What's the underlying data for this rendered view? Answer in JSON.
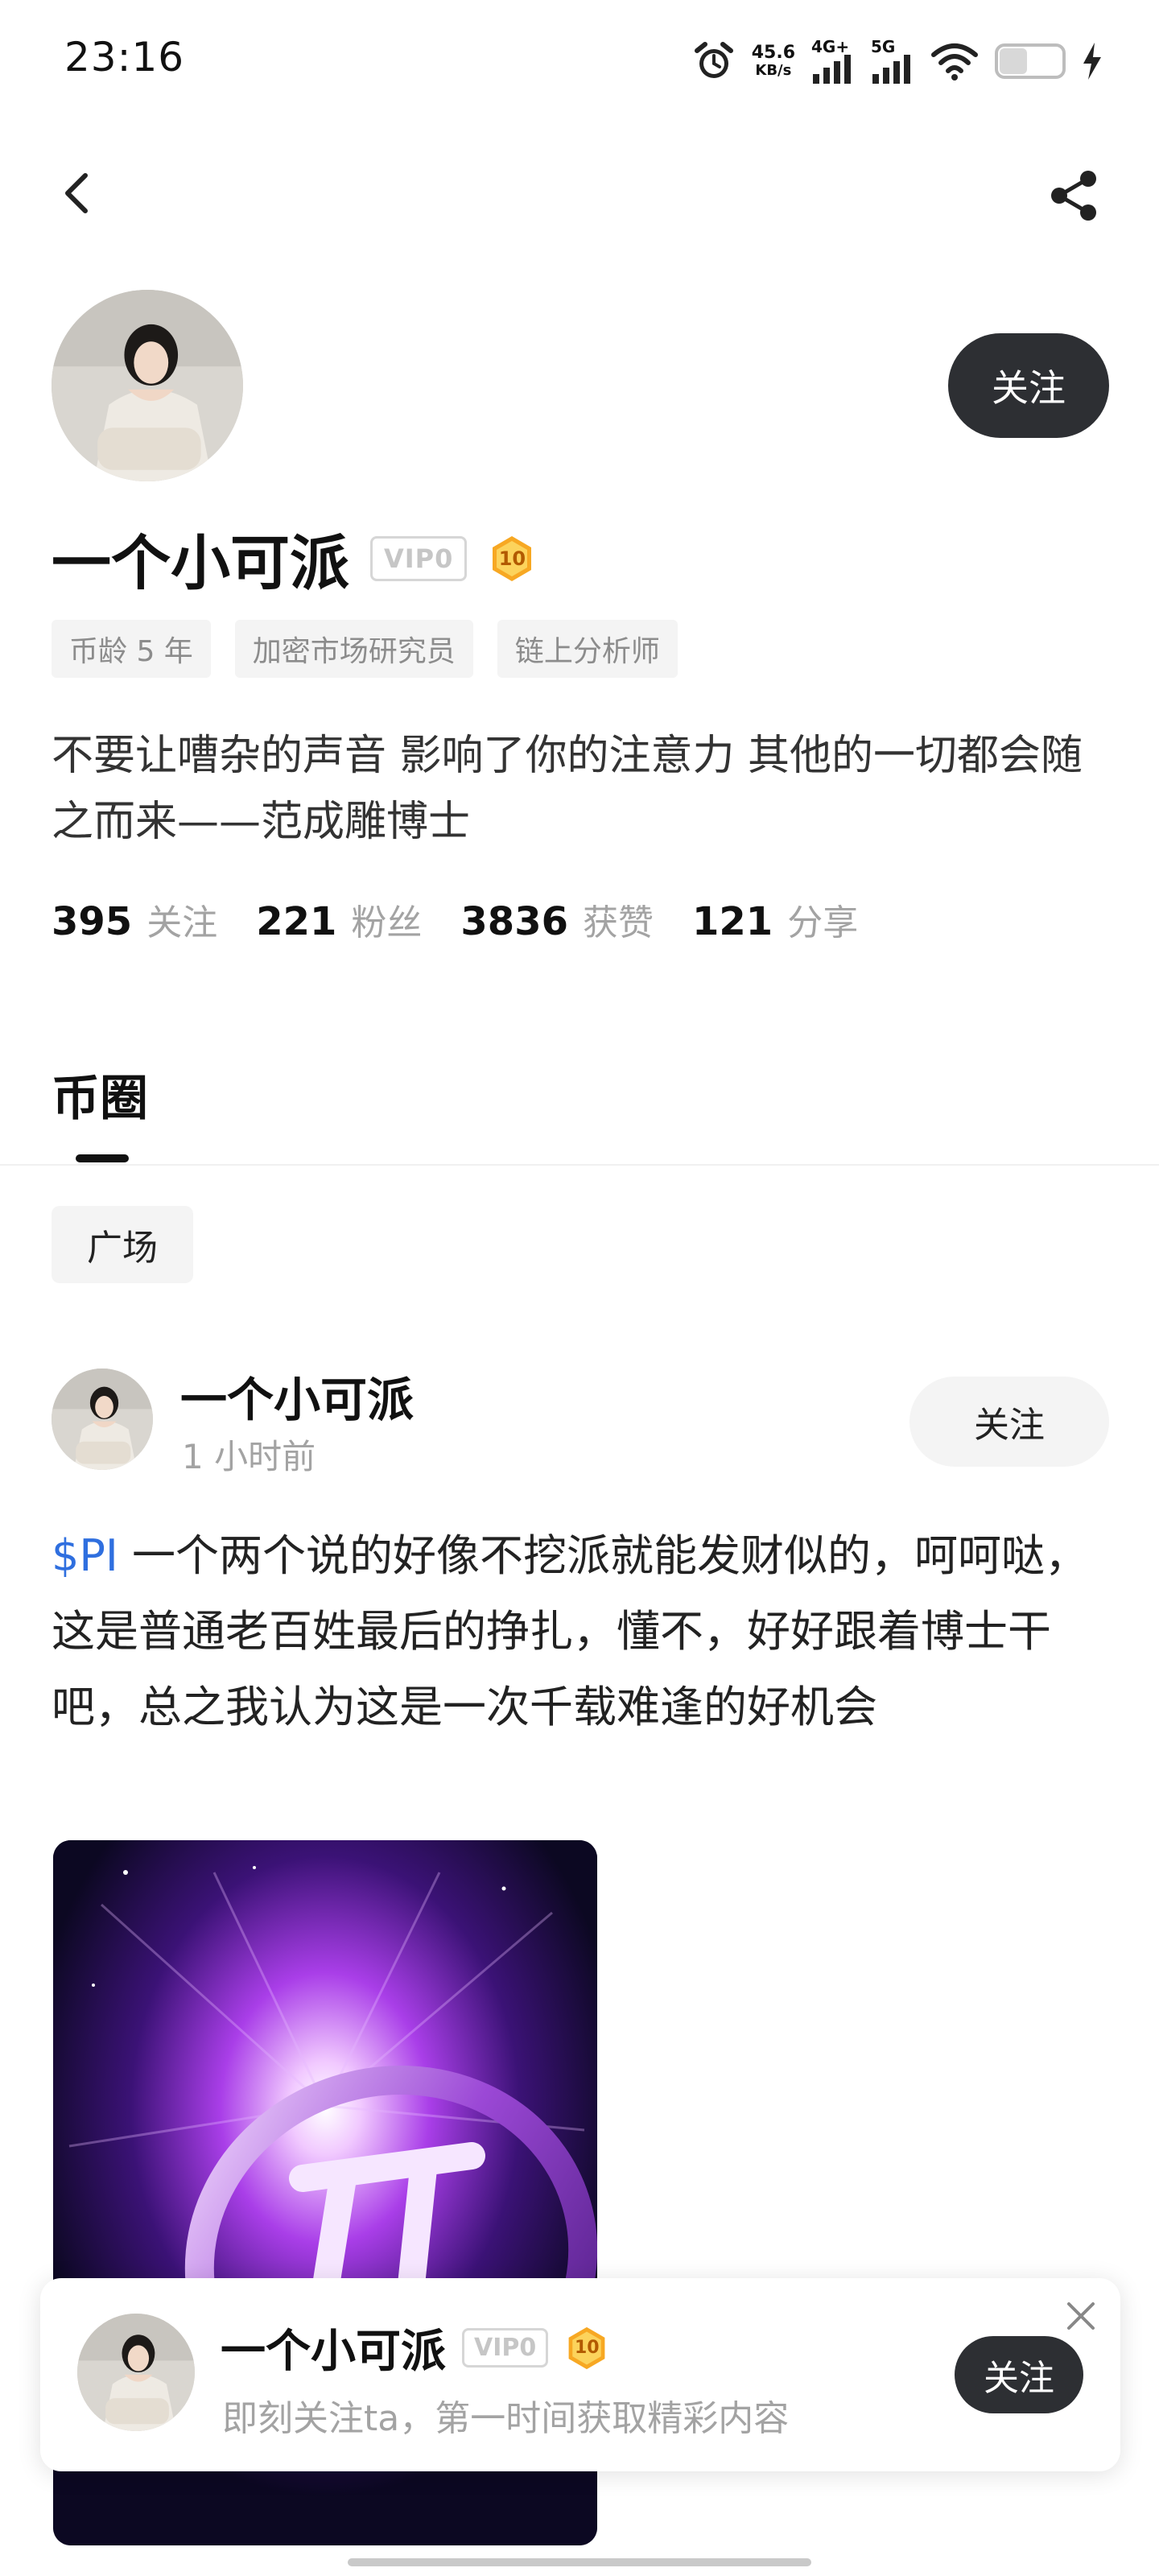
{
  "status_bar": {
    "time": "23:16",
    "net_speed_value": "45.6",
    "net_speed_unit": "KB/s",
    "signal_1": "4G+",
    "signal_2": "5G",
    "icons": [
      "alarm-icon",
      "wifi-icon",
      "battery-icon",
      "charging-icon"
    ]
  },
  "nav": {
    "back_icon": "chevron-left-icon",
    "share_icon": "share-icon"
  },
  "profile": {
    "name": "一个小可派",
    "vip_label": "VIP0",
    "level": "10",
    "follow_label": "关注",
    "tags": [
      "币龄 5 年",
      "加密市场研究员",
      "链上分析师"
    ],
    "bio": "不要让嘈杂的声音 影响了你的注意力 其他的一切都会随之而来——范成雕博士",
    "stats": [
      {
        "value": "395",
        "label": "关注"
      },
      {
        "value": "221",
        "label": "粉丝"
      },
      {
        "value": "3836",
        "label": "获赞"
      },
      {
        "value": "121",
        "label": "分享"
      }
    ]
  },
  "tabs": {
    "active": "币圈"
  },
  "filter": {
    "chip": "广场"
  },
  "post": {
    "author": "一个小可派",
    "time": "1 小时前",
    "follow_label": "关注",
    "ticker": "$PI",
    "text": " 一个两个说的好像不挖派就能发财似的，呵呵哒，这是普通老百姓最后的挣扎，懂不，好好跟着博士干吧，总之我认为这是一次千载难逢的好机会"
  },
  "float_card": {
    "name": "一个小可派",
    "vip_label": "VIP0",
    "level": "10",
    "subtitle": "即刻关注ta，第一时间获取精彩内容",
    "follow_label": "关注"
  },
  "colors": {
    "dark_button": "#2d2f33",
    "ticker_blue": "#2f6fdf",
    "muted_text": "#a3a3a3",
    "chip_bg": "#f4f4f4"
  }
}
